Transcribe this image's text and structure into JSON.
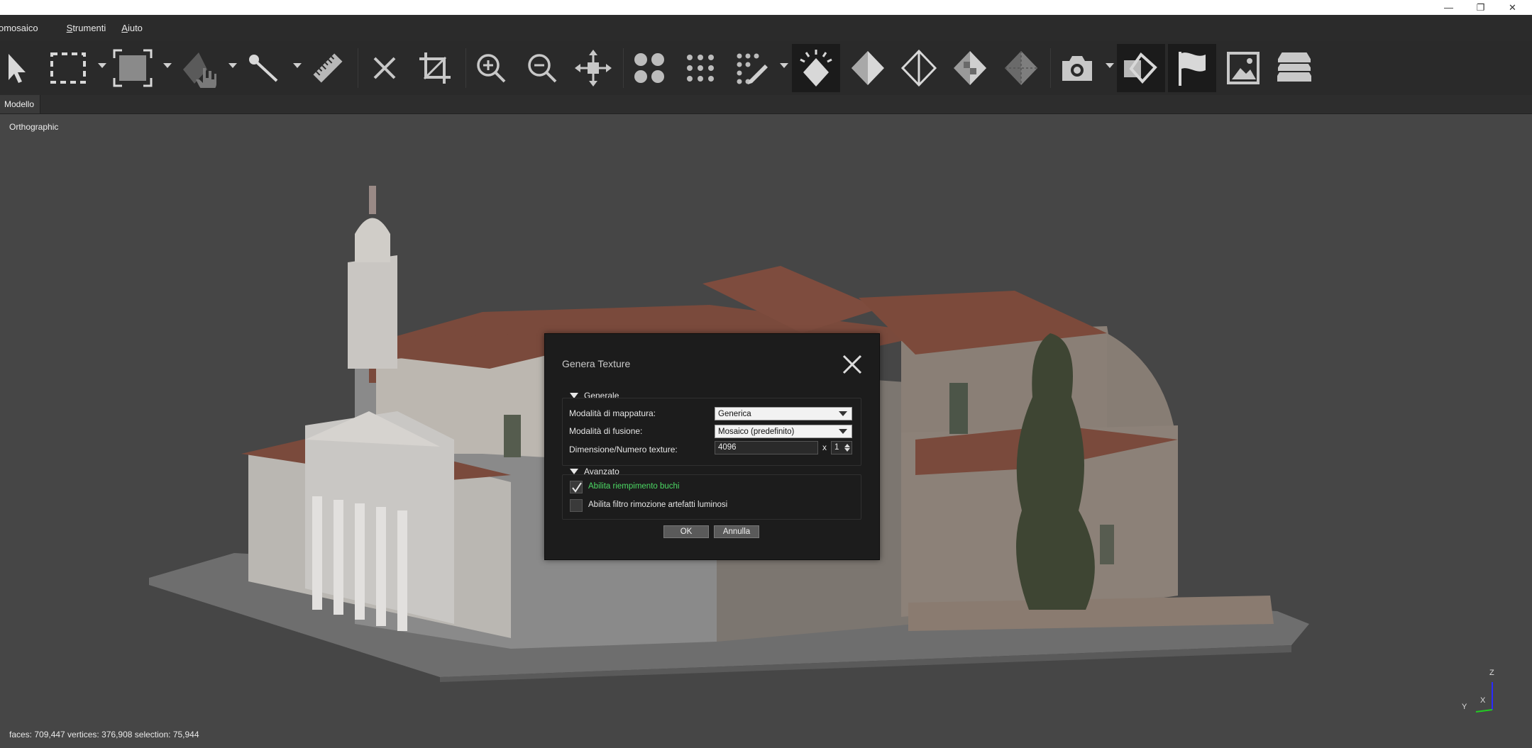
{
  "menu": {
    "items": [
      {
        "label": "omosaico",
        "mnemonic_index": -1
      },
      {
        "label": "Strumenti",
        "mnemonic_index": 0
      },
      {
        "label": "Aiuto",
        "mnemonic_index": 0
      }
    ]
  },
  "window_controls": {
    "minimize": "—",
    "restore": "❐",
    "close": "✕"
  },
  "toolbar": {
    "icons": [
      "select-pointer-icon",
      "rectangle-selection-icon",
      "box-selection-icon",
      "lasso-pan-icon",
      "brush-select-icon",
      "ruler-icon",
      "delete-icon",
      "crop-icon",
      "zoom-in-icon",
      "zoom-out-icon",
      "move-pivot-icon",
      "point-cloud-icon",
      "dense-cloud-icon",
      "edit-points-icon",
      "mesh-lighting-icon",
      "solid-mesh-icon",
      "wireframe-mesh-icon",
      "textured-mesh-icon",
      "vertex-color-mesh-icon",
      "camera-icon",
      "shape-tool-icon",
      "flag-marker-icon",
      "image-icon",
      "layers-icon"
    ]
  },
  "tabs": [
    {
      "label": "Modello"
    }
  ],
  "viewport": {
    "mode": "Orthographic",
    "status": "faces: 709,447 vertices: 376,908 selection: 75,944",
    "axes": {
      "z": "Z",
      "x": "X",
      "y": "Y"
    }
  },
  "dialog": {
    "title": "Genera Texture",
    "sections": {
      "general": "Generale",
      "advanced": "Avanzato"
    },
    "mapping_mode": {
      "label": "Modalità di mappatura:",
      "value": "Generica"
    },
    "blending_mode": {
      "label": "Modalità di fusione:",
      "value": "Mosaico (predefinito)"
    },
    "texture_size": {
      "label": "Dimensione/Numero texture:",
      "size": "4096",
      "times": "x",
      "count": "1"
    },
    "hole_filling": {
      "label": "Abilita riempimento buchi",
      "checked": true
    },
    "ghosting_filter": {
      "label": "Abilita filtro rimozione artefatti luminosi",
      "checked": false
    },
    "ok_label": "OK",
    "cancel_label": "Annulla"
  },
  "colors": {
    "accent_green": "#4cd964",
    "toolbar_bg": "#2a2a2a",
    "viewport_bg": "#464646",
    "dialog_bg": "#1c1c1c"
  }
}
